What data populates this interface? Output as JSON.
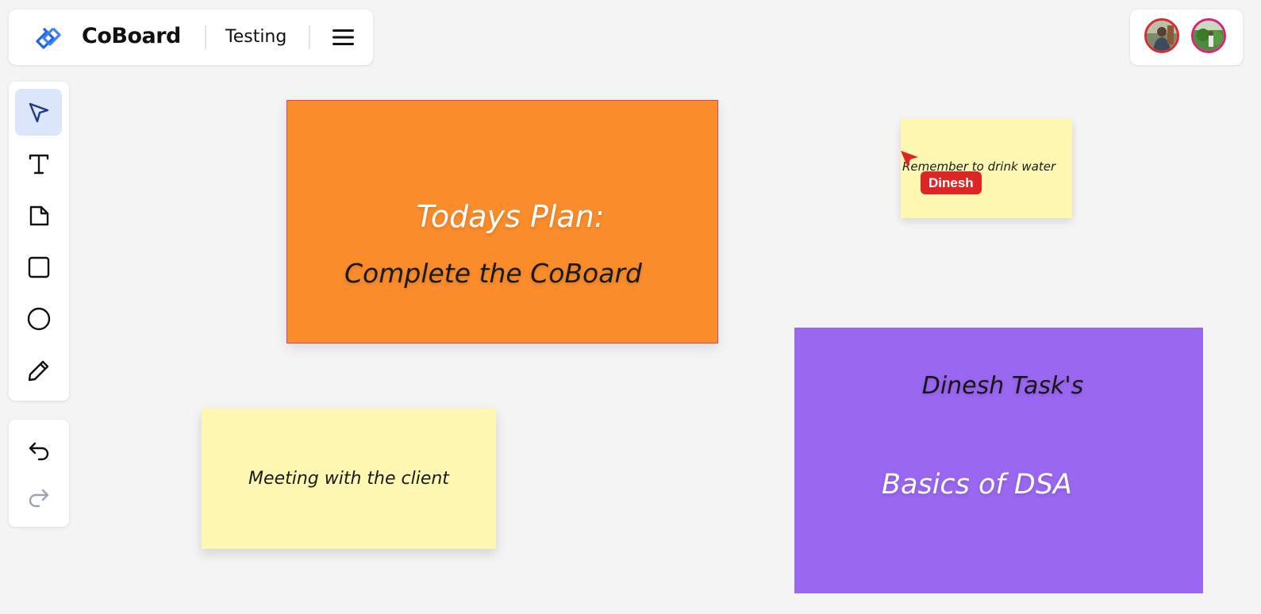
{
  "header": {
    "app_name": "CoBoard",
    "board_name": "Testing",
    "logo_icon": "coboard-logo-icon",
    "menu_icon": "hamburger-menu-icon"
  },
  "collaborators": [
    {
      "icon": "avatar-photo",
      "ring_color": "#e0282c"
    },
    {
      "icon": "avatar-photo",
      "ring_color": "#d9237a"
    }
  ],
  "toolbar": {
    "tools": [
      {
        "icon": "select-pointer-icon",
        "active": true
      },
      {
        "icon": "text-tool-icon",
        "active": false
      },
      {
        "icon": "sticky-note-icon",
        "active": false
      },
      {
        "icon": "rectangle-icon",
        "active": false
      },
      {
        "icon": "circle-icon",
        "active": false
      },
      {
        "icon": "pencil-icon",
        "active": false
      }
    ],
    "history": [
      {
        "icon": "undo-icon",
        "enabled": true
      },
      {
        "icon": "redo-icon",
        "enabled": false
      }
    ]
  },
  "board": {
    "orange_card": {
      "title": "Todays Plan:",
      "body": "Complete the CoBoard",
      "color": "#fa8c2b"
    },
    "small_note": {
      "text": "Remember to drink water",
      "color": "#fef7b1"
    },
    "meeting_note": {
      "text": "Meeting with the client",
      "color": "#fef7b1"
    },
    "purple_card": {
      "title": "Dinesh Task's",
      "body": "Basics of DSA",
      "color": "#9a67f0"
    }
  },
  "remote_cursor": {
    "user": "Dinesh",
    "color": "#dc2626"
  }
}
